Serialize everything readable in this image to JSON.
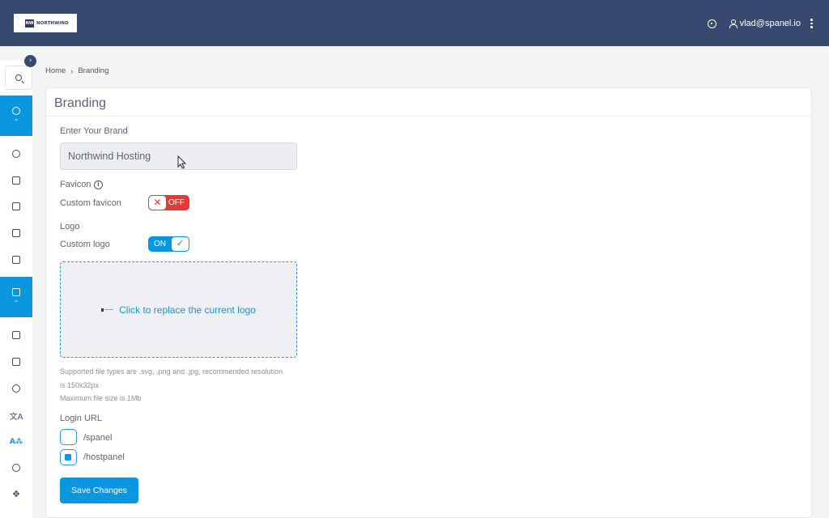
{
  "header": {
    "logo_name": "NORTHWIND",
    "logo_mark": "NW",
    "user_email": "vlad@spanel.io"
  },
  "sidebar": {
    "collapse_glyph": "›",
    "items": [
      {
        "icon": "search-icon"
      },
      {
        "icon": "user-settings-icon",
        "active": true
      },
      {
        "icon": "users-icon"
      },
      {
        "icon": "calendar-icon"
      },
      {
        "icon": "terminal-icon"
      },
      {
        "icon": "package-icon"
      },
      {
        "icon": "card-icon"
      },
      {
        "icon": "server-icon",
        "active": true
      },
      {
        "icon": "document-icon"
      },
      {
        "icon": "disk-icon"
      },
      {
        "icon": "history-icon"
      },
      {
        "icon": "translate-icon"
      },
      {
        "icon": "branding-icon"
      },
      {
        "icon": "shield-icon"
      },
      {
        "icon": "move-icon"
      }
    ]
  },
  "breadcrumb": {
    "home": "Home",
    "separator": "›",
    "current": "Branding"
  },
  "page": {
    "title": "Branding",
    "brand_label": "Enter Your Brand",
    "brand_value": "Northwind Hosting",
    "favicon_label": "Favicon",
    "custom_favicon_label": "Custom favicon",
    "favicon_toggle": {
      "state": "OFF",
      "glyph": "✕"
    },
    "logo_label": "Logo",
    "custom_logo_label": "Custom logo",
    "logo_toggle": {
      "state": "ON",
      "glyph": "✓"
    },
    "dropzone_text": "Click to replace the current logo",
    "help_line1": "Supported file types are .svg, .png and .jpg, recommended resolution",
    "help_line2": "is 150x32px",
    "help_line3": "Maximum file size is 1Mb",
    "login_url_label": "Login URL",
    "login_options": [
      {
        "label": "/spanel",
        "checked": false
      },
      {
        "label": "/hostpanel",
        "checked": true
      }
    ],
    "save_label": "Save Changes"
  },
  "colors": {
    "topbar": "#37496f",
    "accent": "#0b97e0",
    "danger": "#e53935"
  }
}
